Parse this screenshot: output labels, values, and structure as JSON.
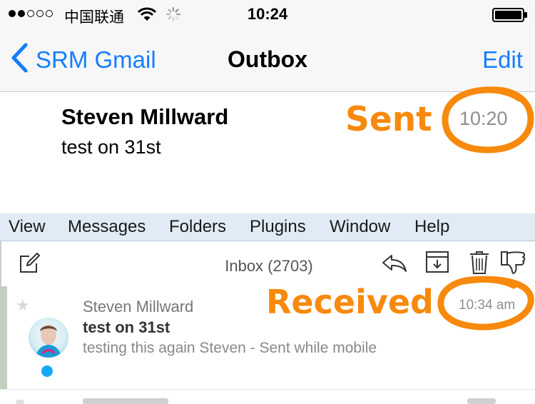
{
  "status_bar": {
    "carrier": "中国联通",
    "time": "10:24",
    "signal_bars_on": 2,
    "signal_bars_total": 5,
    "icons": [
      "wifi-icon",
      "activity-spinner-icon",
      "battery-icon"
    ]
  },
  "nav": {
    "back_label": "SRM Gmail",
    "title": "Outbox",
    "edit_label": "Edit"
  },
  "outbox_message": {
    "sender": "Steven Millward",
    "subject": "test on 31st",
    "time": "10:20"
  },
  "annotations": {
    "sent": "Sent",
    "received": "Received",
    "color": "#f7890c"
  },
  "menubar": {
    "items": [
      "View",
      "Messages",
      "Folders",
      "Plugins",
      "Window",
      "Help"
    ]
  },
  "toolbar": {
    "inbox_title": "Inbox (2703)",
    "icons": [
      "compose-icon",
      "reply-icon",
      "archive-icon",
      "trash-icon",
      "dislike-icon"
    ]
  },
  "received_message": {
    "sender": "Steven Millward",
    "subject": "test on 31st",
    "preview": "testing this again Steven - Sent while mobile",
    "time": "10:34 am",
    "unread": true
  },
  "colors": {
    "ios_blue": "#157efb",
    "unread_dot": "#16a9f5",
    "menubar_bg": "#e0ebf5"
  }
}
